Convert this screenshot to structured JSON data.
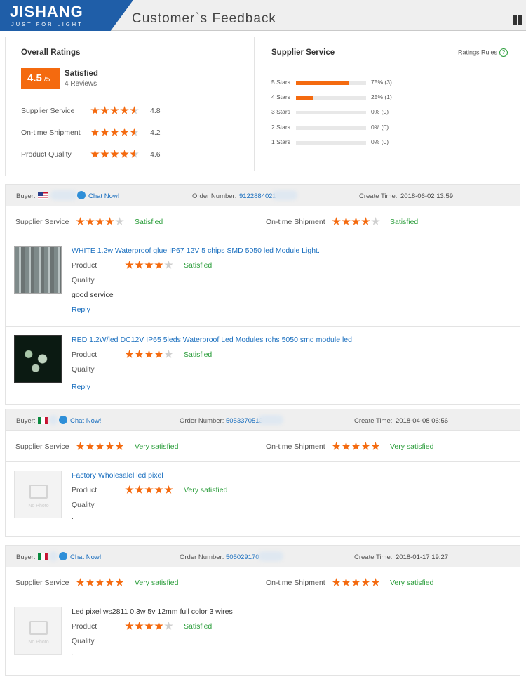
{
  "header": {
    "logo_main": "JISHANG",
    "logo_sub": "JUST FOR LIGHT",
    "title": "Customer`s Feedback"
  },
  "summary": {
    "overall_title": "Overall Ratings",
    "score": "4.5",
    "score_den": "/5",
    "label": "Satisfied",
    "reviews": "4 Reviews",
    "rows": [
      {
        "label": "Supplier Service",
        "value": "4.8",
        "stars": 4.8
      },
      {
        "label": "On-time Shipment",
        "value": "4.2",
        "stars": 4.2
      },
      {
        "label": "Product Quality",
        "value": "4.6",
        "stars": 4.6
      }
    ],
    "supplier_title": "Supplier Service",
    "rules": "Ratings Rules",
    "bars": [
      {
        "label": "5 Stars",
        "pct": "75%",
        "count": "(3)",
        "fill": 0.75
      },
      {
        "label": "4 Stars",
        "pct": "25%",
        "count": "(1)",
        "fill": 0.25
      },
      {
        "label": "3 Stars",
        "pct": "0%",
        "count": "(0)",
        "fill": 0
      },
      {
        "label": "2 Stars",
        "pct": "0%",
        "count": "(0)",
        "fill": 0
      },
      {
        "label": "1 Stars",
        "pct": "0%",
        "count": "(0)",
        "fill": 0
      }
    ]
  },
  "feedback": [
    {
      "buyer_label": "Buyer:",
      "flag": "us-flag-icon",
      "chat": "Chat Now!",
      "order_label": "Order Number:",
      "order_number": "9122884021",
      "create_label": "Create Time:",
      "create_time": "2018-06-02 13:59",
      "supplier_label": "Supplier Service",
      "supplier_stars": 4,
      "supplier_sat": "Satisfied",
      "shipment_label": "On-time Shipment",
      "shipment_stars": 4,
      "shipment_sat": "Satisfied",
      "items": [
        {
          "name": "WHITE 1.2w Waterproof glue IP67 12V 5 chips SMD 5050 led Module Light.",
          "label1": "Product",
          "label2": "Quality",
          "stars": 4,
          "sat": "Satisfied",
          "comment": "good service",
          "reply": "Reply"
        },
        {
          "name": "RED 1.2W/led DC12V IP65 5leds Waterproof Led Modules rohs 5050 smd module led",
          "label1": "Product",
          "label2": "Quality",
          "stars": 4,
          "sat": "Satisfied",
          "reply": "Reply"
        }
      ]
    },
    {
      "buyer_label": "Buyer:",
      "flag": "mx-flag-icon",
      "chat": "Chat Now!",
      "order_label": "Order Number:",
      "order_number": "5053370513",
      "create_label": "Create Time:",
      "create_time": "2018-04-08 06:56",
      "supplier_label": "Supplier Service",
      "supplier_stars": 5,
      "supplier_sat": "Very satisfied",
      "shipment_label": "On-time Shipment",
      "shipment_stars": 5,
      "shipment_sat": "Very satisfied",
      "items": [
        {
          "name": "Factory Wholesalel led pixel",
          "label1": "Product",
          "label2": "Quality",
          "stars": 5,
          "sat": "Very satisfied",
          "dot": ".",
          "no_photo": "No Photo"
        }
      ]
    },
    {
      "buyer_label": "Buyer:",
      "flag": "mx-flag-icon",
      "chat": "Chat Now!",
      "order_label": "Order Number:",
      "order_number": "505029170",
      "create_label": "Create Time:",
      "create_time": "2018-01-17 19:27",
      "supplier_label": "Supplier Service",
      "supplier_stars": 5,
      "supplier_sat": "Very satisfied",
      "shipment_label": "On-time Shipment",
      "shipment_stars": 5,
      "shipment_sat": "Very satisfied",
      "items": [
        {
          "name": "Led pixel ws2811 0.3w 5v 12mm full color 3 wires",
          "label1": "Product",
          "label2": "Quality",
          "stars": 4,
          "sat": "Satisfied",
          "dot": ".",
          "no_photo": "No Photo"
        }
      ]
    }
  ],
  "colors": {
    "accent": "#f46a0f",
    "brand": "#1f5ea8",
    "link": "#1a6fbf",
    "satisfied": "#2a9d3a"
  }
}
